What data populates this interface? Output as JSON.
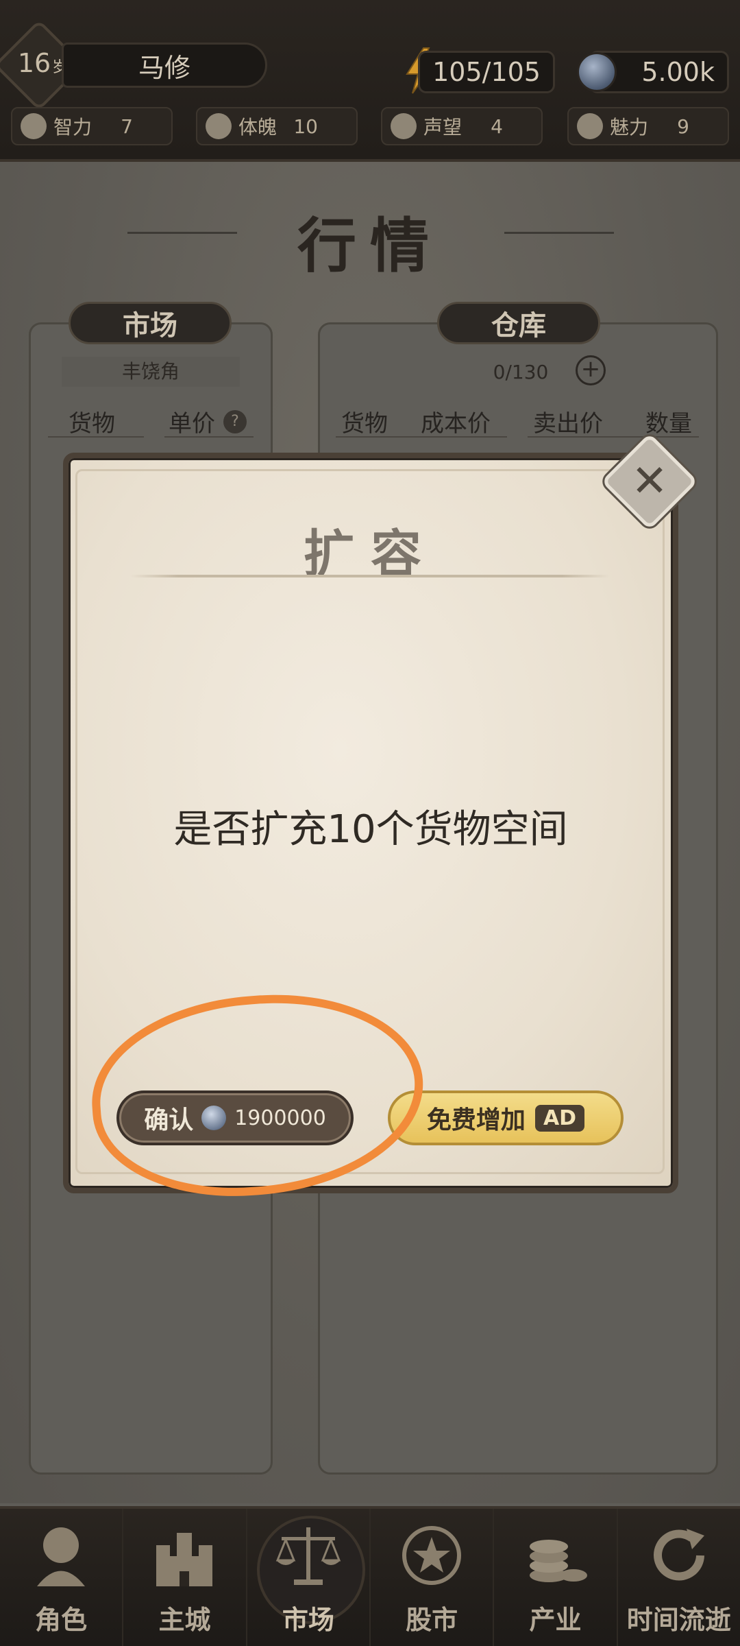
{
  "header": {
    "age": "16",
    "age_unit": "岁",
    "player_name": "马修",
    "energy": "105/105",
    "coins": "5.00k",
    "stats": [
      {
        "label": "智力",
        "value": "7",
        "icon": "brain-icon"
      },
      {
        "label": "体魄",
        "value": "10",
        "icon": "muscle-icon"
      },
      {
        "label": "声望",
        "value": "4",
        "icon": "laurel-icon"
      },
      {
        "label": "魅力",
        "value": "9",
        "icon": "heart-icon"
      }
    ]
  },
  "page": {
    "title": "行情"
  },
  "market_panel": {
    "tab": "市场",
    "location": "丰饶角",
    "columns": [
      "货物",
      "单价"
    ],
    "help": "?"
  },
  "storage_panel": {
    "tab": "仓库",
    "capacity": "0/130",
    "add": "+",
    "columns": [
      "货物",
      "成本价",
      "卖出价",
      "数量"
    ]
  },
  "modal": {
    "title": "扩容",
    "message": "是否扩充10个货物空间",
    "close": "✕",
    "confirm_label": "确认",
    "confirm_price": "1900000",
    "free_label": "免费增加",
    "ad_tag": "AD"
  },
  "bottom_nav": [
    {
      "label": "角色",
      "icon": "character-icon"
    },
    {
      "label": "主城",
      "icon": "castle-icon"
    },
    {
      "label": "市场",
      "icon": "scales-icon",
      "active": true
    },
    {
      "label": "股市",
      "icon": "stock-icon"
    },
    {
      "label": "产业",
      "icon": "coins-icon"
    },
    {
      "label": "时间流逝",
      "icon": "refresh-icon"
    }
  ],
  "colors": {
    "annotation": "#f28b3a",
    "gold_button": "#e7c25b",
    "dark_button": "#5a4c40"
  }
}
